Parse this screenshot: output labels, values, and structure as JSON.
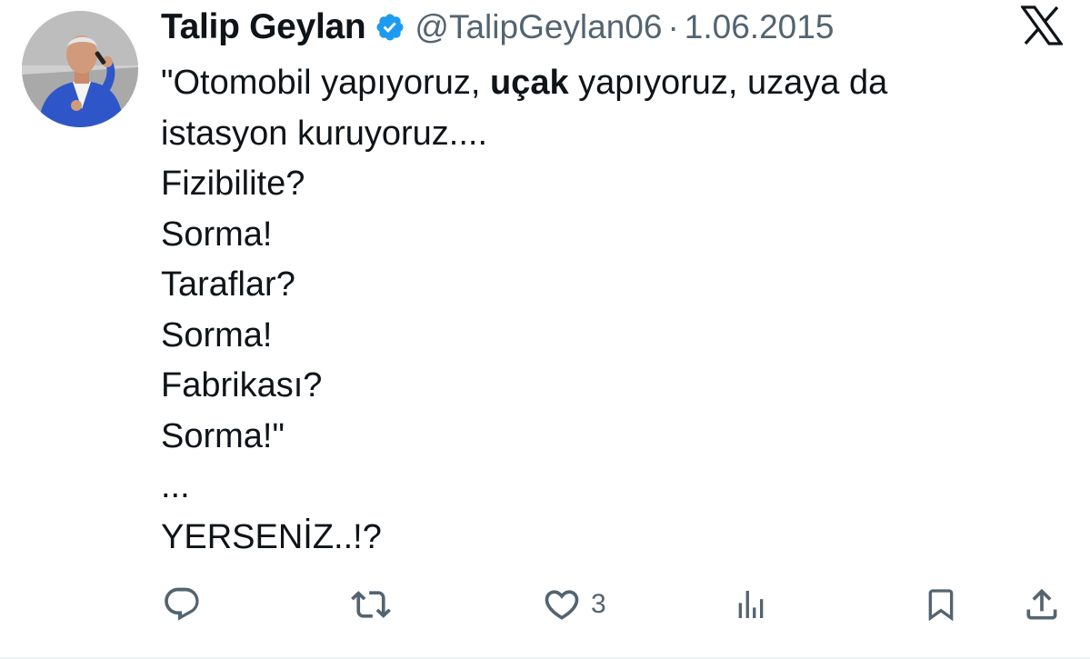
{
  "author": {
    "display_name": "Talip Geylan",
    "handle": "@TalipGeylan06",
    "separator": "·",
    "date": "1.06.2015",
    "verified_icon": "verified-badge-icon",
    "avatar": "profile-photo"
  },
  "platform": {
    "logo": "x-logo-icon"
  },
  "tweet": {
    "line1_pre": "\"Otomobil yapıyoruz, ",
    "line1_bold": "uçak",
    "line1_post": " yapıyoruz, uzaya da",
    "line2": "istasyon kuruyoruz....",
    "line3": "Fizibilite?",
    "line4": "Sorma!",
    "line5": "Taraflar?",
    "line6": "Sorma!",
    "line7": "Fabrikası?",
    "line8": "Sorma!\"",
    "line9": "...",
    "line10": "YERSENİZ..!?"
  },
  "actions": {
    "reply_icon": "reply-icon",
    "retweet_icon": "retweet-icon",
    "like_icon": "heart-icon",
    "like_count": "3",
    "views_icon": "views-icon",
    "bookmark_icon": "bookmark-icon",
    "share_icon": "share-icon"
  },
  "colors": {
    "text": "#0f1419",
    "secondary": "#536471",
    "verified": "#1d9bf0",
    "suit": "#2f56c8"
  }
}
